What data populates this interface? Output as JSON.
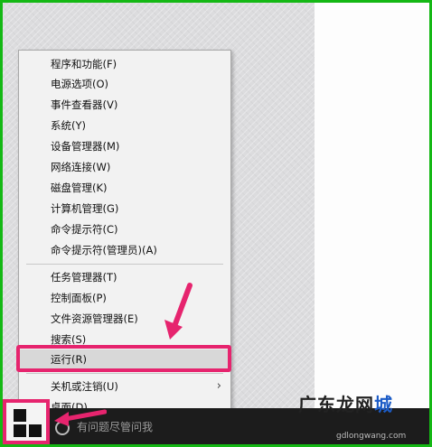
{
  "context_menu": {
    "items": [
      {
        "label": "程序和功能(F)"
      },
      {
        "label": "电源选项(O)"
      },
      {
        "label": "事件查看器(V)"
      },
      {
        "label": "系统(Y)"
      },
      {
        "label": "设备管理器(M)"
      },
      {
        "label": "网络连接(W)"
      },
      {
        "label": "磁盘管理(K)"
      },
      {
        "label": "计算机管理(G)"
      },
      {
        "label": "命令提示符(C)"
      },
      {
        "label": "命令提示符(管理员)(A)"
      },
      {
        "label": "任务管理器(T)"
      },
      {
        "label": "控制面板(P)"
      },
      {
        "label": "文件资源管理器(E)"
      },
      {
        "label": "搜索(S)"
      },
      {
        "label": "运行(R)"
      },
      {
        "label": "关机或注销(U)"
      },
      {
        "label": "桌面(D)"
      }
    ],
    "highlighted_item": "运行(R)"
  },
  "taskbar": {
    "search_placeholder": "有问题尽管问我"
  },
  "watermark": {
    "text_main": "广东龙网",
    "text_accent": "城",
    "url": "gdlongwang.com"
  },
  "colors": {
    "highlight": "#e6246e",
    "frame": "#14b814",
    "taskbar": "#1c1c1c"
  }
}
